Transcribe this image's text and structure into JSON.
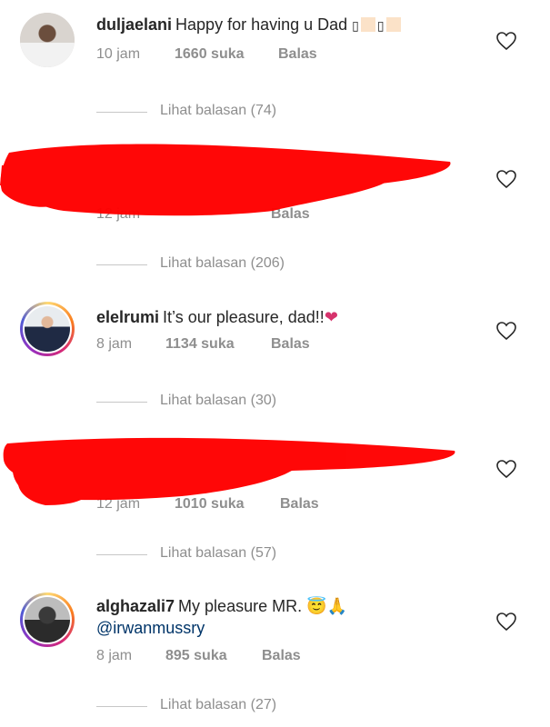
{
  "comments": [
    {
      "username": "duljaelani",
      "text": "Happy for having u Dad",
      "time": "10 jam",
      "likes": "1660 suka",
      "reply": "Balas",
      "view_replies": "Lihat balasan (74)"
    },
    {
      "time": "12 jam",
      "reply": "Balas",
      "view_replies": "Lihat balasan (206)"
    },
    {
      "username": "elelrumi",
      "text": "It’s our pleasure, dad!!",
      "emoji": "❤",
      "time": "8 jam",
      "likes": "1134 suka",
      "reply": "Balas",
      "view_replies": "Lihat balasan (30)"
    },
    {
      "time": "12 jam",
      "likes": "1010 suka",
      "reply": "Balas",
      "view_replies": "Lihat balasan (57)"
    },
    {
      "username": "alghazali7",
      "text": "My pleasure MR.",
      "emoji": "😇🙏",
      "mention": "@irwanmussry",
      "time": "8 jam",
      "likes": "895 suka",
      "reply": "Balas",
      "view_replies": "Lihat balasan (27)"
    }
  ],
  "colors": {
    "text": "#262626",
    "meta": "#8e8e8e",
    "mention": "#003569",
    "redaction": "#ff0000",
    "emoji_heart": "#d6336c"
  },
  "icons": {
    "like": "heart-outline-icon"
  }
}
